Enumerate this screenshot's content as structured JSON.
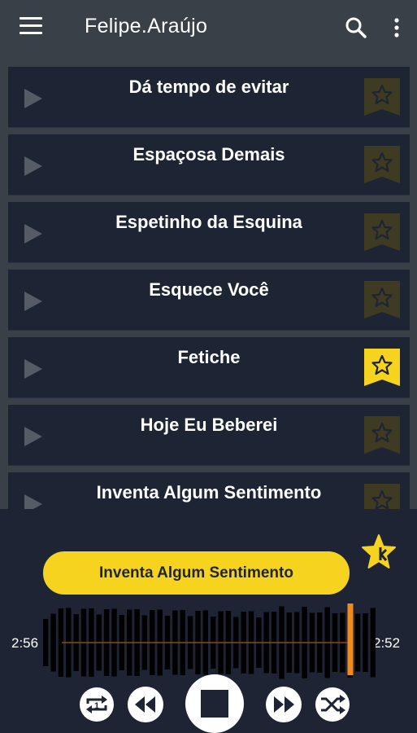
{
  "header": {
    "title": "Felipe.Araújo"
  },
  "songs": [
    {
      "title": "Dá tempo de evitar",
      "favorite": false
    },
    {
      "title": "Espaçosa Demais",
      "favorite": false
    },
    {
      "title": "Espetinho da Esquina",
      "favorite": false
    },
    {
      "title": "Esquece Você",
      "favorite": false
    },
    {
      "title": "Fetiche",
      "favorite": true
    },
    {
      "title": "Hoje Eu Beberei",
      "favorite": false
    },
    {
      "title": "Inventa Algum Sentimento",
      "favorite": false
    }
  ],
  "player": {
    "now_playing": "Inventa Algum Sentimento",
    "elapsed": "2:56",
    "total": "2:52",
    "progress": 0.98
  },
  "colors": {
    "accent": "#f5d31e",
    "row_bg": "#1d2534",
    "app_bg": "#3a4047",
    "playhead": "#f08a1c"
  }
}
